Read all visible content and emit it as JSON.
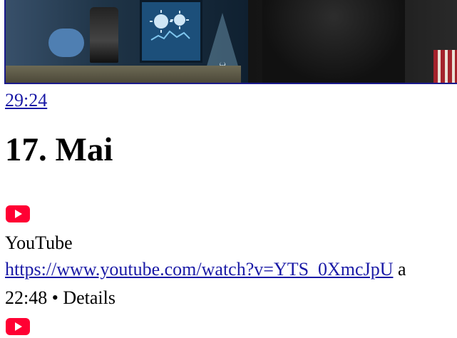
{
  "video": {
    "duration": "29:24"
  },
  "day": {
    "heading": "17. Mai"
  },
  "entry": {
    "icon": "youtube-icon",
    "source": "YouTube",
    "url": "https://www.youtube.com/watch?v=YTS_0XmcJpU",
    "url_trailing": " a",
    "time": "22:48",
    "separator": " • ",
    "details_label": "Details"
  },
  "colors": {
    "youtube_red": "#ff0033",
    "link": "#1a1aa6",
    "thumb_border": "#1a1a8c"
  }
}
